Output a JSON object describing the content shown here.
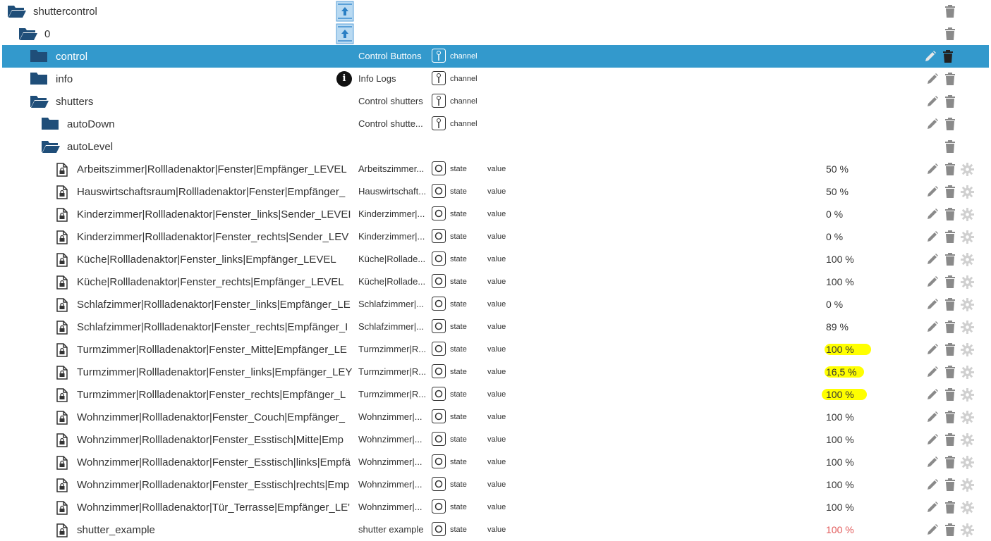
{
  "colors": {
    "selected_bg": "#3399cc",
    "folder": "#1f4e79",
    "highlight": "#ffff00",
    "value_alert": "#e25a5a",
    "icon_gray": "#8a8a8a"
  },
  "tree": {
    "root": {
      "name": "shuttercontrol",
      "icon": "folder-open-icon"
    },
    "instance": {
      "name": "0",
      "icon": "folder-open-icon"
    },
    "control": {
      "name": "control",
      "desc": "Control Buttons",
      "type": "channel"
    },
    "info": {
      "name": "info",
      "desc": "Info Logs",
      "type": "channel"
    },
    "shutters": {
      "name": "shutters",
      "desc": "Control shutters",
      "type": "channel"
    },
    "autoDown": {
      "name": "autoDown",
      "desc": "Control shutte...",
      "type": "channel"
    },
    "autoLevel": {
      "name": "autoLevel"
    }
  },
  "states": [
    {
      "name": "Arbeitszimmer|Rollladenaktor|Fenster|Empfänger_LEVEL",
      "desc": "Arbeitszimmer...",
      "type": "state",
      "role": "value",
      "value": "50 %"
    },
    {
      "name": "Hauswirtschaftsraum|Rollladenaktor|Fenster|Empfänger_",
      "desc": "Hauswirtschaft...",
      "type": "state",
      "role": "value",
      "value": "50 %"
    },
    {
      "name": "Kinderzimmer|Rollladenaktor|Fenster_links|Sender_LEVEI",
      "desc": "Kinderzimmer|...",
      "type": "state",
      "role": "value",
      "value": "0 %"
    },
    {
      "name": "Kinderzimmer|Rollladenaktor|Fenster_rechts|Sender_LEV",
      "desc": "Kinderzimmer|...",
      "type": "state",
      "role": "value",
      "value": "0 %"
    },
    {
      "name": "Küche|Rollladenaktor|Fenster_links|Empfänger_LEVEL",
      "desc": "Küche|Rollade...",
      "type": "state",
      "role": "value",
      "value": "100 %"
    },
    {
      "name": "Küche|Rollladenaktor|Fenster_rechts|Empfänger_LEVEL",
      "desc": "Küche|Rollade...",
      "type": "state",
      "role": "value",
      "value": "100 %"
    },
    {
      "name": "Schlafzimmer|Rollladenaktor|Fenster_links|Empfänger_LE",
      "desc": "Schlafzimmer|...",
      "type": "state",
      "role": "value",
      "value": "0 %"
    },
    {
      "name": "Schlafzimmer|Rollladenaktor|Fenster_rechts|Empfänger_I",
      "desc": "Schlafzimmer|...",
      "type": "state",
      "role": "value",
      "value": "89 %"
    },
    {
      "name": "Turmzimmer|Rollladenaktor|Fenster_Mitte|Empfänger_LE",
      "desc": "Turmzimmer|R...",
      "type": "state",
      "role": "value",
      "value": "100 %",
      "highlighted": true
    },
    {
      "name": "Turmzimmer|Rollladenaktor|Fenster_links|Empfänger_LEY",
      "desc": "Turmzimmer|R...",
      "type": "state",
      "role": "value",
      "value": "16,5 %",
      "highlighted": true
    },
    {
      "name": "Turmzimmer|Rollladenaktor|Fenster_rechts|Empfänger_L",
      "desc": "Turmzimmer|R...",
      "type": "state",
      "role": "value",
      "value": "100 %",
      "highlighted": true
    },
    {
      "name": "Wohnzimmer|Rollladenaktor|Fenster_Couch|Empfänger_",
      "desc": "Wohnzimmer|...",
      "type": "state",
      "role": "value",
      "value": "100 %"
    },
    {
      "name": "Wohnzimmer|Rollladenaktor|Fenster_Esstisch|Mitte|Emp",
      "desc": "Wohnzimmer|...",
      "type": "state",
      "role": "value",
      "value": "100 %"
    },
    {
      "name": "Wohnzimmer|Rollladenaktor|Fenster_Esstisch|links|Empfä",
      "desc": "Wohnzimmer|...",
      "type": "state",
      "role": "value",
      "value": "100 %"
    },
    {
      "name": "Wohnzimmer|Rollladenaktor|Fenster_Esstisch|rechts|Emp",
      "desc": "Wohnzimmer|...",
      "type": "state",
      "role": "value",
      "value": "100 %"
    },
    {
      "name": "Wohnzimmer|Rollladenaktor|Tür_Terrasse|Empfänger_LE'",
      "desc": "Wohnzimmer|...",
      "type": "state",
      "role": "value",
      "value": "100 %"
    },
    {
      "name": "shutter_example",
      "desc": "shutter example",
      "type": "state",
      "role": "value",
      "value": "100 %",
      "alert": true
    }
  ]
}
